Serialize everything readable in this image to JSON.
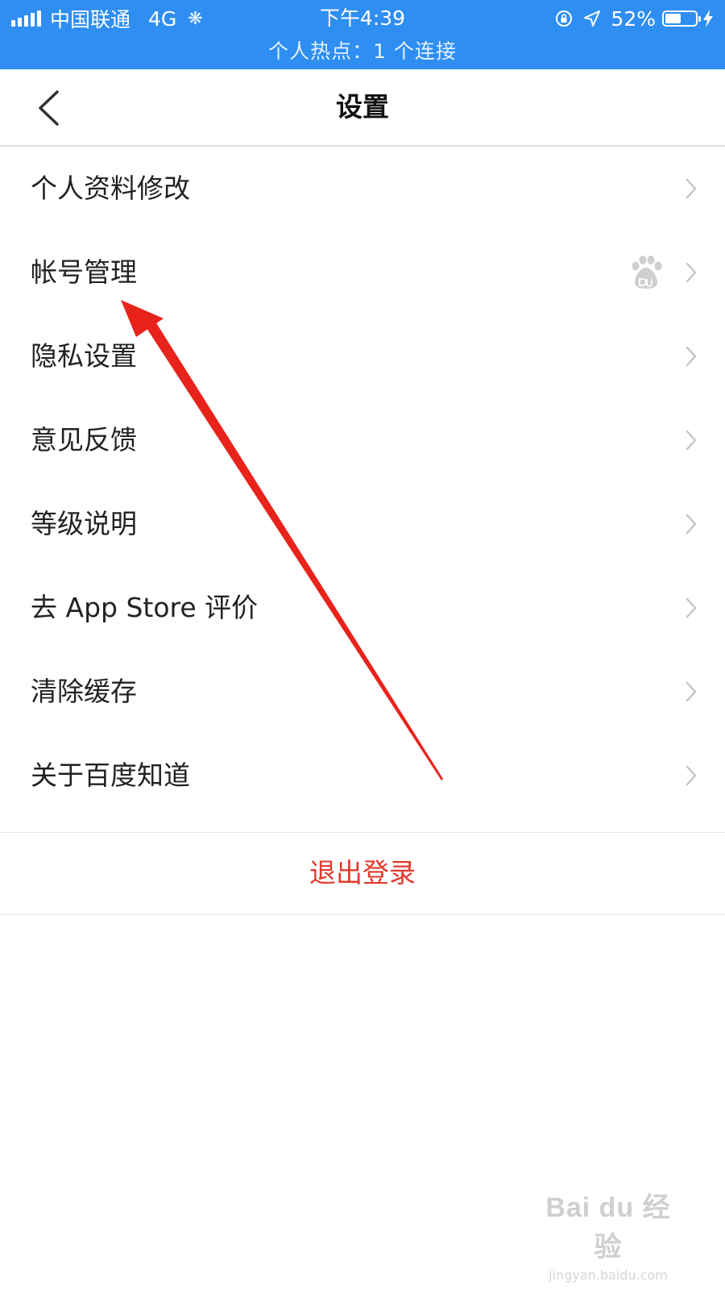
{
  "status_bar": {
    "carrier": "中国联通",
    "network": "4G",
    "time": "下午4:39",
    "battery_percent": "52%",
    "battery_level": 0.52,
    "hotspot": "个人热点：1 个连接",
    "background_color": "#2e8ef2",
    "icons": [
      "signal-bars-icon",
      "loading-spinner-icon",
      "orientation-lock-icon",
      "location-arrow-icon",
      "battery-icon",
      "charging-bolt-icon"
    ]
  },
  "nav": {
    "title": "设置",
    "back_icon": "chevron-left-icon"
  },
  "menu": {
    "items": [
      {
        "label": "个人资料修改"
      },
      {
        "label": "帐号管理",
        "accessory_icon": "baidu-paw-icon"
      },
      {
        "label": "隐私设置"
      },
      {
        "label": "意见反馈"
      },
      {
        "label": "等级说明"
      },
      {
        "label": "去 App Store 评价"
      },
      {
        "label": "清除缓存"
      },
      {
        "label": "关于百度知道"
      }
    ],
    "chevron_icon": "chevron-right-icon"
  },
  "logout": {
    "label": "退出登录",
    "color": "#e23a2e"
  },
  "annotation": {
    "type": "red-arrow",
    "points_to": "帐号管理",
    "color": "#e8231c"
  },
  "watermark": {
    "logo": "Bai du 经验",
    "domain": "jingyan.baidu.com"
  }
}
